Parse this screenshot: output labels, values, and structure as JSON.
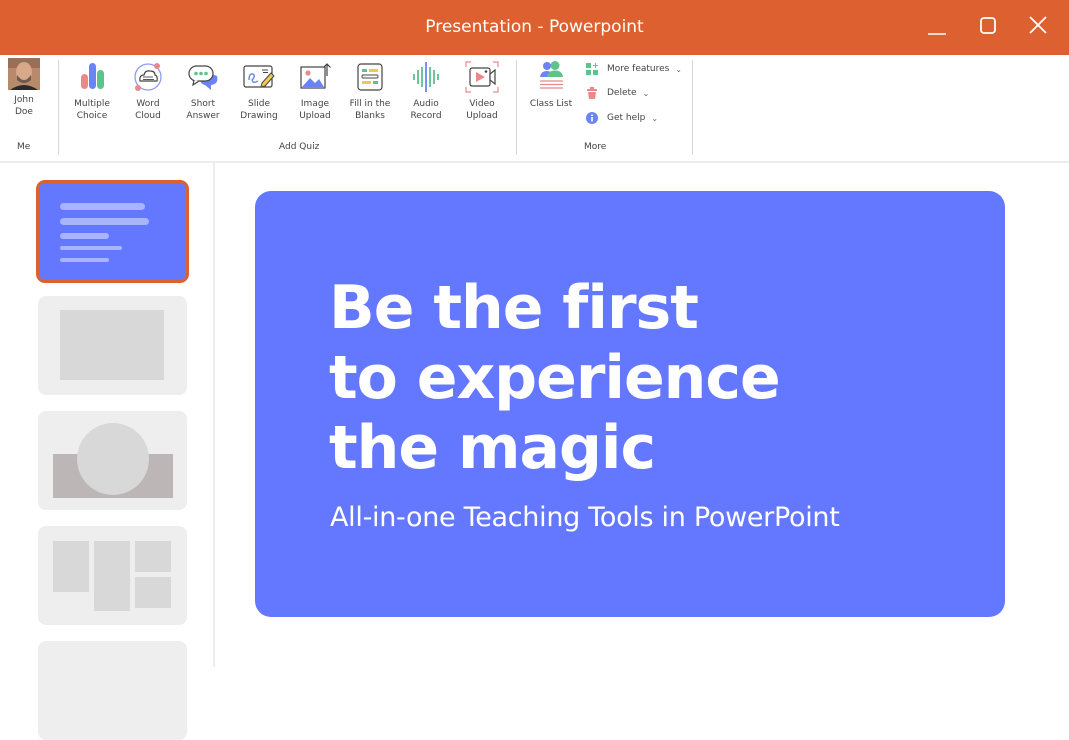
{
  "window": {
    "title": "Presentation - Powerpoint",
    "accent_color": "#DD6130",
    "controls": {
      "minimize": "minimize-icon",
      "maximize": "maximize-icon",
      "close": "close-icon"
    }
  },
  "ribbon": {
    "me": {
      "name_line1": "John",
      "name_line2": "Doe",
      "group_label": "Me"
    },
    "add_quiz": {
      "group_label": "Add Quiz",
      "tools": [
        {
          "line1": "Multiple",
          "line2": "Choice",
          "icon": "bar-chart-icon"
        },
        {
          "line1": "Word",
          "line2": "Cloud",
          "icon": "word-cloud-icon"
        },
        {
          "line1": "Short",
          "line2": "Answer",
          "icon": "speech-bubble-icon"
        },
        {
          "line1": "Slide",
          "line2": "Drawing",
          "icon": "slide-drawing-icon"
        },
        {
          "line1": "Image",
          "line2": "Upload",
          "icon": "image-upload-icon"
        },
        {
          "line1": "Fill in the",
          "line2": "Blanks",
          "icon": "fill-blanks-icon"
        },
        {
          "line1": "Audio",
          "line2": "Record",
          "icon": "audio-wave-icon"
        },
        {
          "line1": "Video",
          "line2": "Upload",
          "icon": "video-upload-icon"
        }
      ]
    },
    "more": {
      "group_label": "More",
      "class_list": "Class List",
      "items": [
        {
          "label": "More features",
          "icon": "grid-plus-icon"
        },
        {
          "label": "Delete",
          "icon": "trash-icon"
        },
        {
          "label": "Get help",
          "icon": "info-icon"
        }
      ],
      "dropdown_glyph": "⌄"
    }
  },
  "sidebar": {
    "thumbnails": [
      {
        "layout": "title-text",
        "active": true
      },
      {
        "layout": "single-image",
        "active": false
      },
      {
        "layout": "circle-banner",
        "active": false
      },
      {
        "layout": "grid",
        "active": false
      },
      {
        "layout": "blank",
        "active": false
      }
    ]
  },
  "slide": {
    "background_color": "#6478FF",
    "headline_line1": "Be the first",
    "headline_line2": "to experience",
    "headline_line3": "the magic",
    "subtitle": "All-in-one Teaching Tools in PowerPoint"
  }
}
